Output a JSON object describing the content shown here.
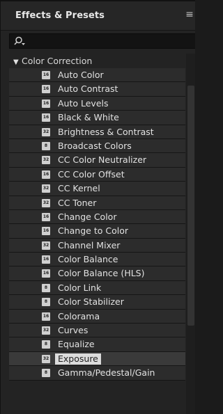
{
  "panel": {
    "title": "Effects & Presets",
    "menu_icon": "hamburger-menu-icon"
  },
  "search": {
    "value": "",
    "icon": "search-dropdown-icon"
  },
  "category": {
    "label": "Color Correction",
    "expanded": true
  },
  "effects": [
    {
      "label": "Auto Color",
      "bpc": "16"
    },
    {
      "label": "Auto Contrast",
      "bpc": "16"
    },
    {
      "label": "Auto Levels",
      "bpc": "16"
    },
    {
      "label": "Black & White",
      "bpc": "16"
    },
    {
      "label": "Brightness & Contrast",
      "bpc": "32"
    },
    {
      "label": "Broadcast Colors",
      "bpc": "8"
    },
    {
      "label": "CC Color Neutralizer",
      "bpc": "32"
    },
    {
      "label": "CC Color Offset",
      "bpc": "16"
    },
    {
      "label": "CC Kernel",
      "bpc": "32"
    },
    {
      "label": "CC Toner",
      "bpc": "32"
    },
    {
      "label": "Change Color",
      "bpc": "16"
    },
    {
      "label": "Change to Color",
      "bpc": "16"
    },
    {
      "label": "Channel Mixer",
      "bpc": "32"
    },
    {
      "label": "Color Balance",
      "bpc": "16"
    },
    {
      "label": "Color Balance (HLS)",
      "bpc": "16"
    },
    {
      "label": "Color Link",
      "bpc": "8"
    },
    {
      "label": "Color Stabilizer",
      "bpc": "8"
    },
    {
      "label": "Colorama",
      "bpc": "16"
    },
    {
      "label": "Curves",
      "bpc": "32"
    },
    {
      "label": "Equalize",
      "bpc": "8"
    },
    {
      "label": "Exposure",
      "bpc": "32",
      "selected": true
    },
    {
      "label": "Gamma/Pedestal/Gain",
      "bpc": "8"
    }
  ]
}
